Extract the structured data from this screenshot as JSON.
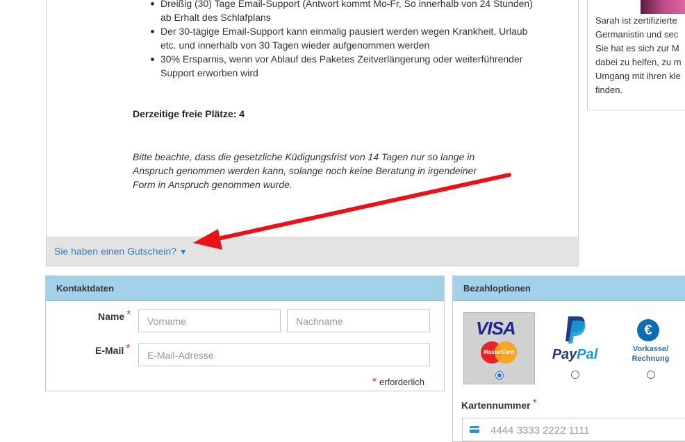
{
  "product": {
    "bullets": [
      "Dreißig (30) Tage Email-Support (Antwort kommt Mo-Fr, So innerhalb von 24 Stunden) ab Erhalt des Schlafplans",
      "Der 30-tägige Email-Support kann einmalig pausiert werden wegen Krankheit, Urlaub etc. und innerhalb von 30 Tagen wieder aufgenommen werden",
      "30% Ersparnis, wenn vor Ablauf des Paketes Zeitverlängerung oder weiterführender Support erworben wird"
    ],
    "free_places": "Derzeitige freie Plätze: 4",
    "notice": "Bitte beachte, dass die gesetzliche Küdigungsfrist von 14 Tagen nur so lange in Anspruch genommen werden kann, solange noch keine Beratung in irgendeiner Form in Anspruch genommen wurde.",
    "voucher_link": "Sie haben einen Gutschein?",
    "voucher_arrow": "▼"
  },
  "sidebar": {
    "text": "Sarah ist zertifizierte\nGermanistin und sec\nSie hat es sich zur M\ndabei zu helfen, zu m\nUmgang mit ihren kle\nfinden."
  },
  "contact": {
    "title": "Kontaktdaten",
    "name_label": "Name",
    "email_label": "E-Mail",
    "required_star": "*",
    "firstname_placeholder": "Vorname",
    "lastname_placeholder": "Nachname",
    "email_placeholder": "E-Mail-Adresse",
    "required_note": "erforderlich"
  },
  "payment": {
    "title": "Bezahloptionen",
    "options": [
      {
        "name": "credit-card",
        "visa": "VISA",
        "mastercard": "MasterCard",
        "selected": true
      },
      {
        "name": "paypal",
        "pay": "Pay",
        "pal": "Pal",
        "selected": false
      },
      {
        "name": "vorkasse",
        "euro": "€",
        "label_line1": "Vorkasse/",
        "label_line2": "Rechnung",
        "selected": false
      }
    ],
    "card_label": "Kartennummer",
    "card_placeholder": "4444 3333 2222 1111"
  },
  "colors": {
    "panel_header": "#a3d1ea",
    "link": "#3a7bb8",
    "required": "#c0392b",
    "arrow": "#e8121b"
  }
}
